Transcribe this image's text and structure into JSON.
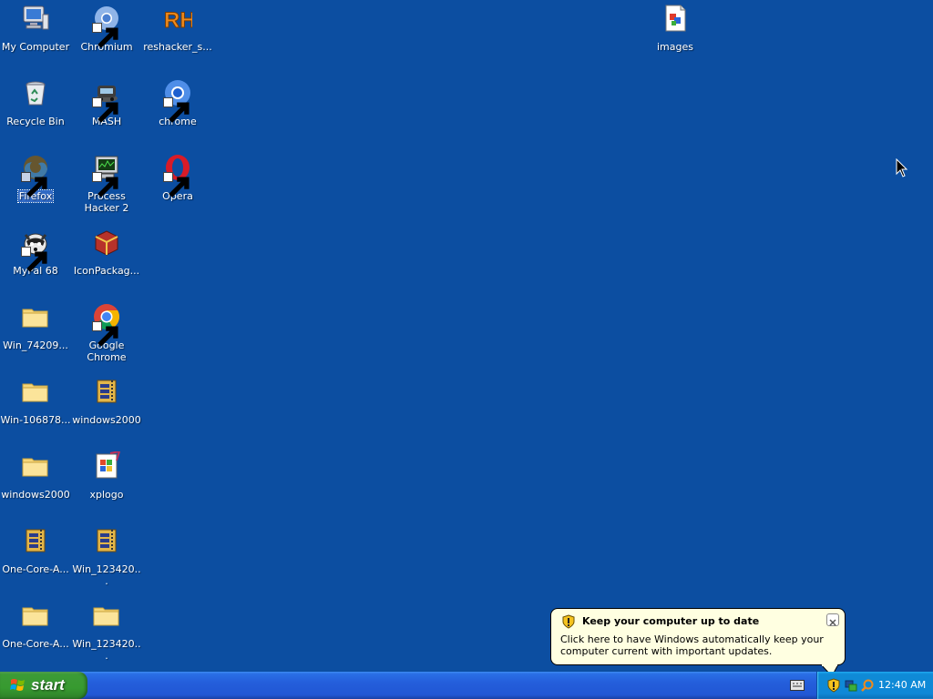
{
  "desktop": {
    "icons": [
      {
        "label": "My Computer",
        "icon": "my-computer-icon"
      },
      {
        "label": "Recycle Bin",
        "icon": "recycle-bin-icon"
      },
      {
        "label": "Firefox",
        "icon": "firefox-icon"
      },
      {
        "label": "MyPal 68",
        "icon": "mypal-icon"
      },
      {
        "label": "Win_74209...",
        "icon": "folder-icon"
      },
      {
        "label": "Win-106878...",
        "icon": "folder-icon"
      },
      {
        "label": "windows2000",
        "icon": "folder-icon"
      },
      {
        "label": "One-Core-A...",
        "icon": "archive-icon"
      },
      {
        "label": "One-Core-A...",
        "icon": "folder-icon"
      },
      {
        "label": "Chromium",
        "icon": "chromium-icon"
      },
      {
        "label": "MASH",
        "icon": "mash-icon"
      },
      {
        "label": "Process Hacker 2",
        "icon": "process-hacker-icon"
      },
      {
        "label": "IconPackag...",
        "icon": "iconpackager-icon"
      },
      {
        "label": "Google Chrome",
        "icon": "chrome-icon"
      },
      {
        "label": "windows2000",
        "icon": "archive-icon"
      },
      {
        "label": "xplogo",
        "icon": "image-file-icon"
      },
      {
        "label": "Win_123420...",
        "icon": "archive-icon"
      },
      {
        "label": "Win_123420...",
        "icon": "folder-icon"
      },
      {
        "label": "reshacker_s...",
        "icon": "reshacker-icon"
      },
      {
        "label": "chrome",
        "icon": "chromium-blue-icon"
      },
      {
        "label": "Opera",
        "icon": "opera-icon"
      },
      {
        "label": "images",
        "icon": "images-file-icon"
      }
    ],
    "selected": "Firefox"
  },
  "taskbar": {
    "start_label": "start",
    "clock": "12:40 AM"
  },
  "balloon": {
    "title": "Keep your computer up to date",
    "text": "Click here to have Windows automatically keep your computer current with important updates."
  },
  "colors": {
    "desktop": "#0c4ea1",
    "taskbar": "#245edb",
    "start": "#379a30",
    "tray": "#0f8ad6",
    "balloon": "#ffffe1"
  }
}
